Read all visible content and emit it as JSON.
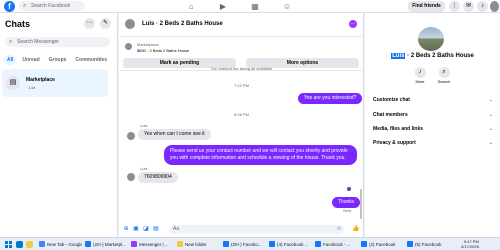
{
  "top_nav": {
    "search_placeholder": "Search Facebook",
    "find_friends": "Find friends",
    "notif_count": ""
  },
  "sidebar": {
    "title": "Chats",
    "search_placeholder": "Search Messenger",
    "filters": [
      "All",
      "Unread",
      "Groups",
      "Communities"
    ],
    "active_filter": "All",
    "conversations": [
      {
        "name": "Marketplace",
        "sub": "· 14d"
      }
    ]
  },
  "chat": {
    "header_title": "Luis · 2 Beds 2 Baths House",
    "listing": {
      "category": "Marketplace",
      "description": "$890 · 2 Beds 2 Baths House",
      "mark_pending": "Mark as pending",
      "more_options": "More options"
    },
    "system_note": "You marked the listing as available",
    "timestamps": [
      "7:22 PM",
      "8:26 PM"
    ],
    "messages": [
      {
        "from": "me",
        "text": "Yes are you interested?"
      },
      {
        "from": "them",
        "sender": "Luis",
        "text": "Yes when can I come see it"
      },
      {
        "from": "me",
        "text": "Please send us your contact number and we will contact you shortly and provide you with complete information and schedule a viewing of the house. Thank you."
      },
      {
        "from": "them",
        "sender": "Luis",
        "text": "7609809904"
      },
      {
        "from": "me",
        "text": "Thanks"
      }
    ],
    "sent_label": "Sent",
    "composer_placeholder": "Aa"
  },
  "right_panel": {
    "name_highlight": "Luis",
    "name_rest": " · 2 Beds 2 Baths House",
    "actions": [
      {
        "label": "Mute",
        "icon": "bell-icon"
      },
      {
        "label": "Search",
        "icon": "search-icon"
      }
    ],
    "sections": [
      "Customize chat",
      "Chat members",
      "Media, files and links",
      "Privacy & support"
    ]
  },
  "taskbar": {
    "items": [
      {
        "label": "New Tab - Google",
        "color": "#4285f4"
      },
      {
        "label": "(20+) Marketpl...",
        "color": "#1877f2"
      },
      {
        "label": "Messenger | ...",
        "color": "#a033ff"
      },
      {
        "label": "New folder",
        "color": "#f2c94c"
      },
      {
        "label": "(20+) Facebo...",
        "color": "#1877f2"
      },
      {
        "label": "(4) Facebook ...",
        "color": "#1877f2"
      },
      {
        "label": "Facebook - ...",
        "color": "#1877f2"
      },
      {
        "label": "(2) Facebook",
        "color": "#1877f2"
      },
      {
        "label": "(5) Facebook",
        "color": "#1877f2"
      }
    ],
    "time": "9:47 PM",
    "date": "3/17/2025"
  },
  "colors": {
    "brand": "#1877f2",
    "outgoing_bubble": "#7a28ff",
    "incoming_bubble": "#e4e6eb"
  }
}
